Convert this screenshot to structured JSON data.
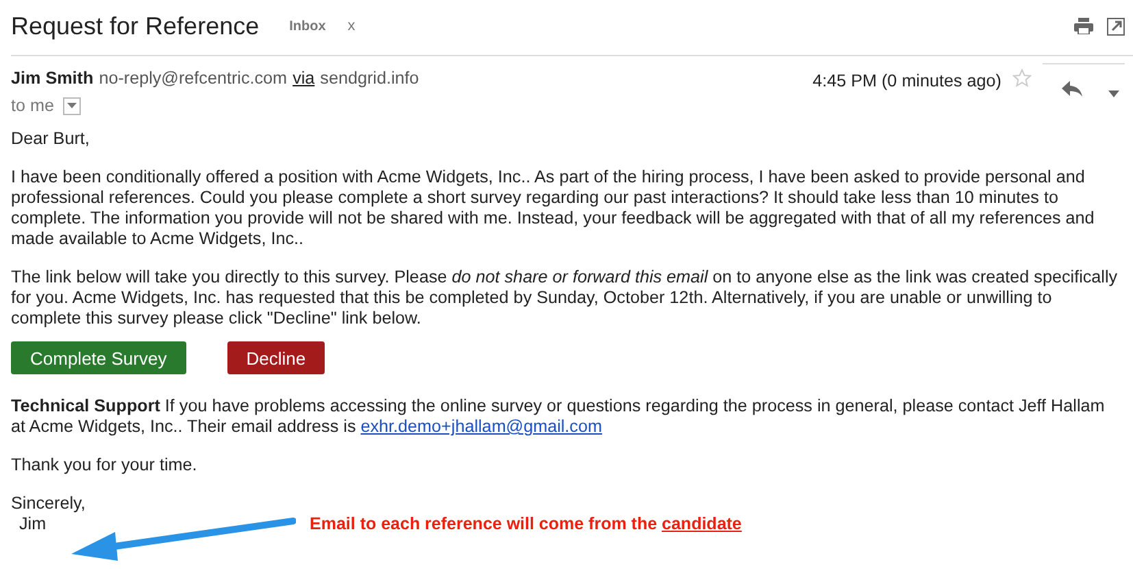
{
  "subject": "Request for Reference",
  "label": {
    "text": "Inbox",
    "close": "x"
  },
  "sender": {
    "name": "Jim Smith",
    "email": "no-reply@refcentric.com",
    "via": "via",
    "domain": "sendgrid.info",
    "time": "4:45 PM (0 minutes ago)",
    "starred": false,
    "recipient": "to me"
  },
  "greeting": "Dear Burt,",
  "paragraphs": [
    "I have been conditionally offered a position with Acme Widgets, Inc.. As part of the hiring process, I have been asked to provide personal and professional references. Could you please complete a short survey regarding our past interactions? It should take less than 10 minutes to complete. The information you provide will not be shared with me. Instead, your feedback will be aggregated with that of all my references and made available to Acme Widgets, Inc..",
    "The link below will take you directly to this survey. Please *do not share or forward this email* on to anyone else as the link was created specifically for you. Acme Widgets, Inc. has requested that this be completed by Sunday, October 12th. Alternatively, if you are unable or unwilling to complete this survey please click \"Decline\" link below."
  ],
  "buttons": [
    {
      "label": "Complete Survey",
      "kind": "primary"
    },
    {
      "label": "Decline",
      "kind": "danger"
    }
  ],
  "support": {
    "text": "**Technical Support** If you have problems accessing the online survey or questions regarding the process in general, please contact Jeff Hallam at Acme Widgets, Inc.. Their email address is",
    "link": "exhr.demo+jhallam@gmail.com"
  },
  "thanks": "Thank you for your time.",
  "closing": "Sincerely,",
  "signature": "Jim",
  "annotation": {
    "text": "Email to each reference will come from the",
    "underlined": "candidate"
  }
}
